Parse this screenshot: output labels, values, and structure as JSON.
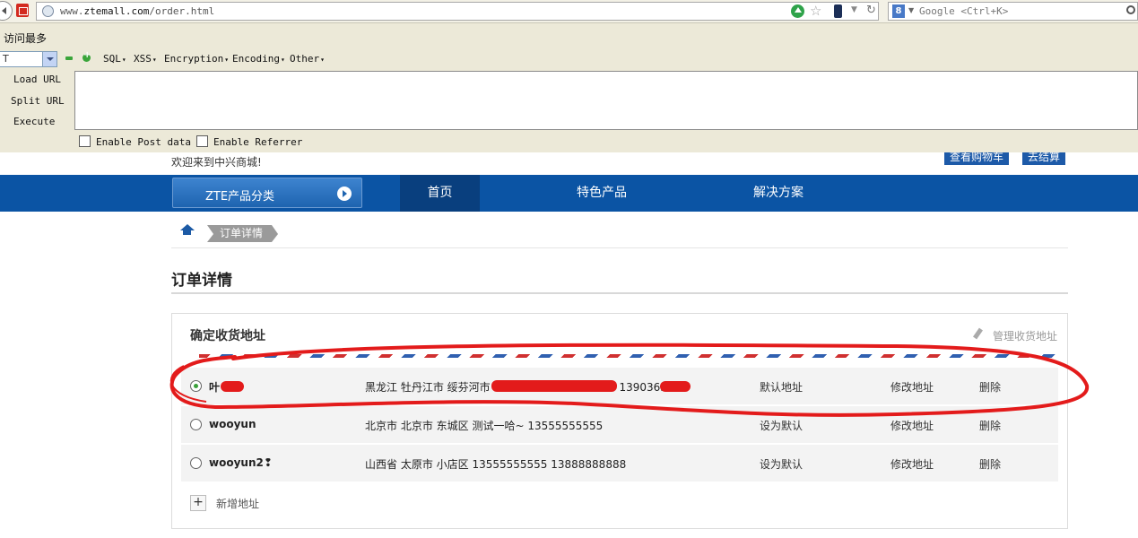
{
  "browser": {
    "url_prefix": "www.",
    "url_domain": "ztemall.com",
    "url_path": "/order.html",
    "search_placeholder": "Google <Ctrl+K>",
    "search_engine_letter": "8",
    "bookmark": "访问最多"
  },
  "hackbar": {
    "select_value": "T",
    "menus": [
      "SQL",
      "XSS",
      "Encryption",
      "Encoding",
      "Other"
    ],
    "load_url": "Load URL",
    "split_url": "Split URL",
    "execute": "Execute",
    "post_label": "Enable Post data",
    "referrer_label": "Enable Referrer"
  },
  "header": {
    "welcome": "欢迎来到中兴商城!",
    "cart_button": "查看购物车",
    "checkout_button": "去结算"
  },
  "nav": {
    "category_button": "ZTE产品分类",
    "items": [
      "首页",
      "特色产品",
      "解决方案"
    ]
  },
  "breadcrumb": {
    "current": "订单详情"
  },
  "page_title": "订单详情",
  "address_panel": {
    "title": "确定收货地址",
    "manage": "管理收货地址",
    "rows": [
      {
        "name": "叶",
        "address": "黑龙江 牡丹江市 绥芬河市 ",
        "phone": "13903635",
        "default_label": "默认地址",
        "edit": "修改地址",
        "delete": "删除",
        "selected": true
      },
      {
        "name": "wooyun",
        "address": "北京市 北京市 东城区 测试一哈~ 13555555555",
        "default_label": "设为默认",
        "edit": "修改地址",
        "delete": "删除",
        "selected": false
      },
      {
        "name": "wooyun2❢",
        "address": "山西省 太原市 小店区 13555555555 13888888888",
        "default_label": "设为默认",
        "edit": "修改地址",
        "delete": "删除",
        "selected": false
      }
    ],
    "add_label": "新增地址"
  },
  "colors": {
    "nav_blue": "#0b54a4",
    "nav_active": "#093f7e",
    "annotation_red": "#e31b1b"
  }
}
